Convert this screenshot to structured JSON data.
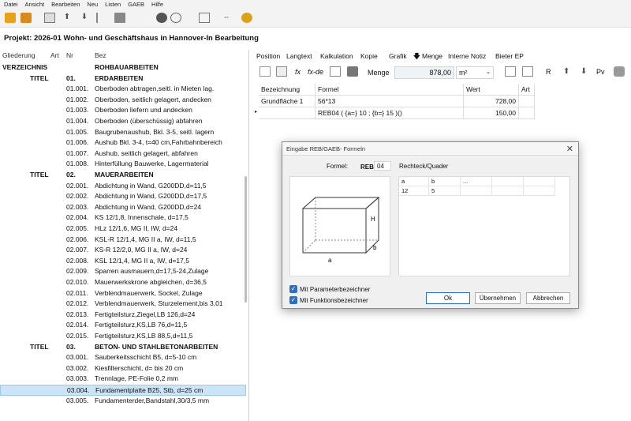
{
  "menubar": [
    "Datei",
    "Ansicht",
    "Bearbeiten",
    "Neu",
    "Listen",
    "GAEB",
    "Hilfe"
  ],
  "project_title": "Projekt:  2026-01 Wohn- und Geschäftshaus in Hannover-In Bearbeitung",
  "tree": {
    "headers": {
      "gliederung": "Gliederung",
      "art": "Art",
      "nr": "Nr",
      "bez": "Bez"
    },
    "rows": [
      {
        "g": "VERZEICHNIS",
        "nr": "",
        "bez": "ROHBAUARBEITEN",
        "bold": true
      },
      {
        "g": "TITEL",
        "nr": "01.",
        "bez": "ERDARBEITEN",
        "bold": true
      },
      {
        "g": "",
        "nr": "01.001.",
        "bez": "Oberboden abtragen,seitl. in Mieten lag."
      },
      {
        "g": "",
        "nr": "01.002.",
        "bez": "Oberboden, seitlich gelagert, andecken"
      },
      {
        "g": "",
        "nr": "01.003.",
        "bez": "Oberboden liefern und andecken"
      },
      {
        "g": "",
        "nr": "01.004.",
        "bez": "Oberboden (überschüssig) abfahren"
      },
      {
        "g": "",
        "nr": "01.005.",
        "bez": "Baugrubenaushub, Bkl. 3-5, seitl. lagern"
      },
      {
        "g": "",
        "nr": "01.006.",
        "bez": "Aushub Bkl. 3-4, t=40 cm,Fahrbahnbereich"
      },
      {
        "g": "",
        "nr": "01.007.",
        "bez": "Aushub, seitlich gelagert, abfahren"
      },
      {
        "g": "",
        "nr": "01.008.",
        "bez": "Hinterfüllung Bauwerke, Lagermaterial"
      },
      {
        "g": "TITEL",
        "nr": "02.",
        "bez": "MAUERARBEITEN",
        "bold": true
      },
      {
        "g": "",
        "nr": "02.001.",
        "bez": "Abdichtung in Wand, G200DD,d=11,5"
      },
      {
        "g": "",
        "nr": "02.002.",
        "bez": "Abdichtung in Wand, G200DD,d=17,5"
      },
      {
        "g": "",
        "nr": "02.003.",
        "bez": "Abdichtung in Wand, G200DD,d=24"
      },
      {
        "g": "",
        "nr": "02.004.",
        "bez": "KS 12/1,8, Innenschale, d=17,5"
      },
      {
        "g": "",
        "nr": "02.005.",
        "bez": "HLz 12/1,6, MG II, IW, d=24"
      },
      {
        "g": "",
        "nr": "02.006.",
        "bez": "KSL-R 12/1,4, MG II a, IW, d=11,5"
      },
      {
        "g": "",
        "nr": "02.007.",
        "bez": "KS-R 12/2,0, MG II a, IW, d=24"
      },
      {
        "g": "",
        "nr": "02.008.",
        "bez": "KSL 12/1,4, MG II a, IW, d=17,5"
      },
      {
        "g": "",
        "nr": "02.009.",
        "bez": "Sparren ausmauern,d=17,5-24,Zulage"
      },
      {
        "g": "",
        "nr": "02.010.",
        "bez": "Mauerwerkskrone abgleichen, d=36,5"
      },
      {
        "g": "",
        "nr": "02.011.",
        "bez": "Verblendmauerwerk, Sockel, Zulage"
      },
      {
        "g": "",
        "nr": "02.012.",
        "bez": "Verblendmauerwerk, Sturzelement,bis 3,01"
      },
      {
        "g": "",
        "nr": "02.013.",
        "bez": "Fertigteilsturz,Ziegel,LB 126,d=24"
      },
      {
        "g": "",
        "nr": "02.014.",
        "bez": "Fertigteilsturz,KS,LB 76,d=11,5"
      },
      {
        "g": "",
        "nr": "02.015.",
        "bez": "Fertigteilsturz,KS,LB 88,5,d=11,5"
      },
      {
        "g": "TITEL",
        "nr": "03.",
        "bez": "BETON- UND STAHLBETONARBEITEN",
        "bold": true
      },
      {
        "g": "",
        "nr": "03.001.",
        "bez": "Sauberkeitsschicht B5, d=5-10 cm"
      },
      {
        "g": "",
        "nr": "03.002.",
        "bez": "Kiesfilterschicht, d= bis 20 cm"
      },
      {
        "g": "",
        "nr": "03.003.",
        "bez": "Trennlage, PE-Folie 0,2 mm"
      },
      {
        "g": "",
        "nr": "03.004.",
        "bez": "Fundamentplatte B25, Stb, d=25 cm",
        "selected": true
      },
      {
        "g": "",
        "nr": "03.005.",
        "bez": "Fundamenterder,Bandstahl,30/3,5 mm"
      }
    ]
  },
  "tabs": [
    "Position",
    "Langtext",
    "Kalkulation",
    "Kopie",
    "Grafik",
    "Menge",
    "Interne Notiz",
    "Bieter EP"
  ],
  "rtool": {
    "fx": "fx",
    "fxde": "fx-de",
    "menge_label": "Menge",
    "menge_value": "878,00",
    "unit": "m²",
    "r": "R",
    "pv": "Pv"
  },
  "grid": {
    "headers": [
      "Bezeichnung",
      "Formel",
      "Wert",
      "Art"
    ],
    "rows": [
      [
        "Grundfläche 1",
        "56*13",
        "728,00",
        ""
      ],
      [
        "",
        "REB04 ( {a=} 10 ; {b=} 15 )()",
        "150,00",
        ""
      ]
    ]
  },
  "dialog": {
    "title": "Eingabe REB/GAEB- Formeln",
    "formel_label": "Formel:",
    "reb": "REB",
    "reb_nr": "04",
    "shape_name": "Rechteck/Quader",
    "dim_labels": {
      "h": "H",
      "a": "a",
      "b": "b"
    },
    "param_headers": [
      "a",
      "b",
      "..."
    ],
    "param_values": [
      "12",
      "5"
    ],
    "chk1": "Mit Parameterbezeichner",
    "chk2": "Mit Funktionsbezeichner",
    "ok": "Ok",
    "uebernehmen": "Übernehmen",
    "abbrechen": "Abbrechen"
  }
}
